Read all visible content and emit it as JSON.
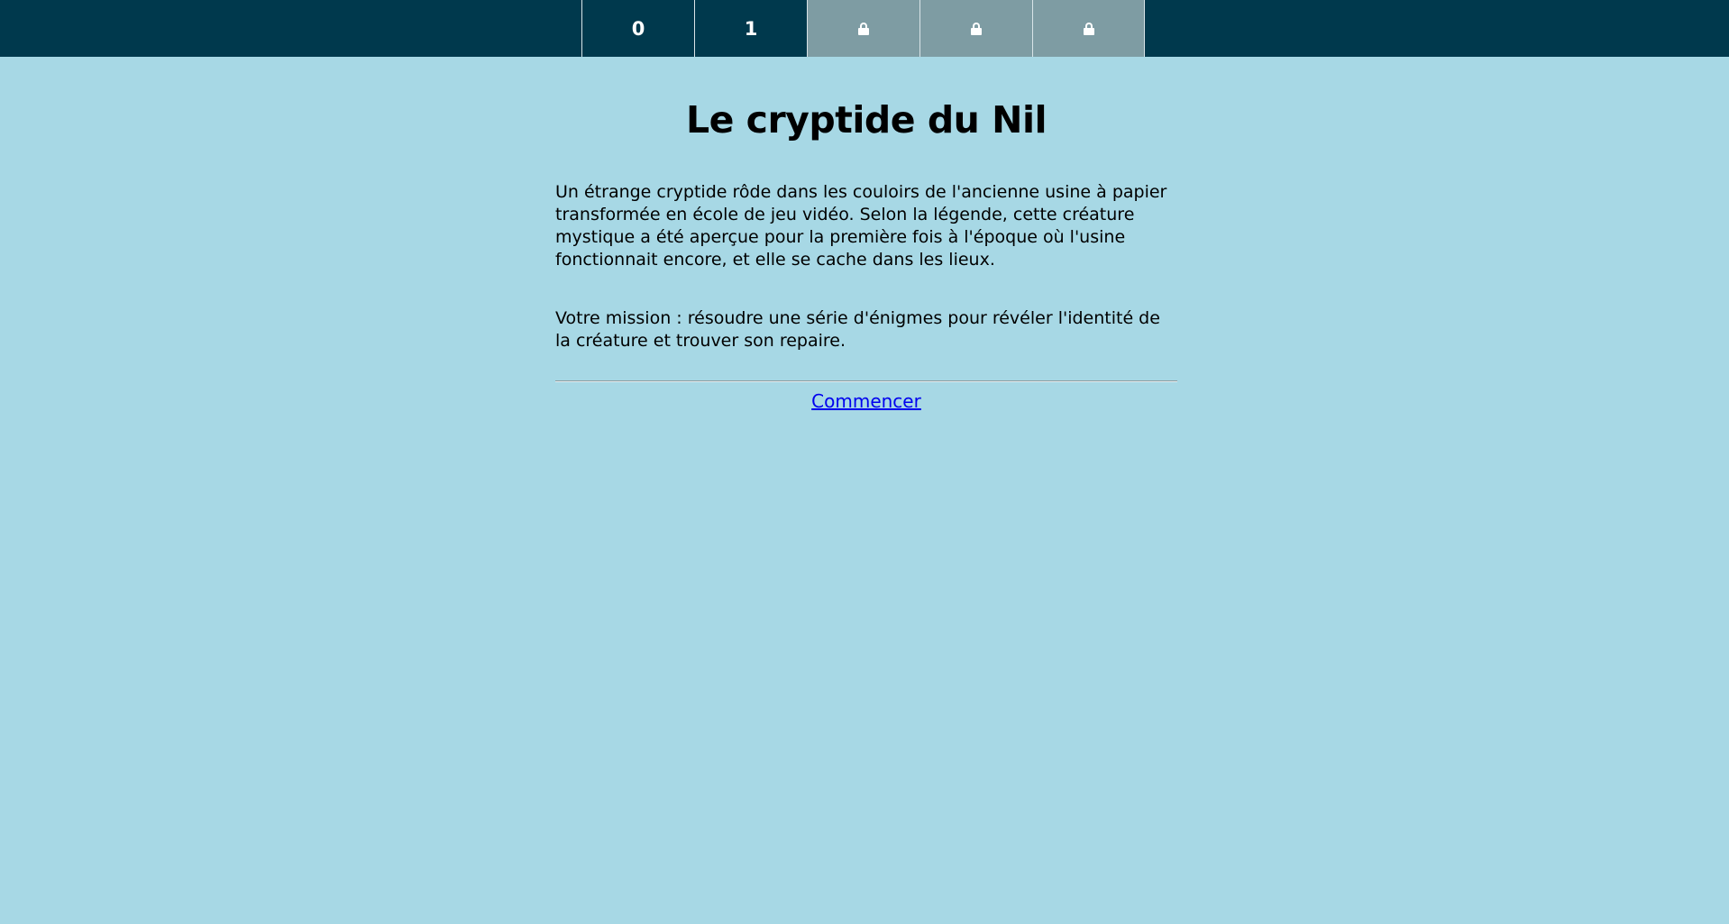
{
  "nav": {
    "tabs": [
      {
        "label": "0",
        "state": "unlocked"
      },
      {
        "label": "1",
        "state": "unlocked"
      },
      {
        "icon": "lock-icon",
        "state": "locked"
      },
      {
        "icon": "lock-icon",
        "state": "locked"
      },
      {
        "icon": "lock-icon",
        "state": "locked"
      }
    ]
  },
  "main": {
    "title": "Le cryptide du Nil",
    "intro": "Un étrange cryptide rôde dans les couloirs de l'ancienne usine à papier transformée en école de jeu vidéo. Selon la légende, cette créature mystique a été aperçue pour la première fois à l'époque où l'usine fonctionnait encore, et elle se cache dans les lieux.",
    "mission": "Votre mission : résoudre une série d'énigmes pour révéler l'identité de la créature et trouver son repaire.",
    "start_label": "Commencer"
  },
  "colors": {
    "background": "#a7d8e5",
    "topbar": "#00394d",
    "locked_tab": "#7e9ca3",
    "link": "#0000ee"
  }
}
